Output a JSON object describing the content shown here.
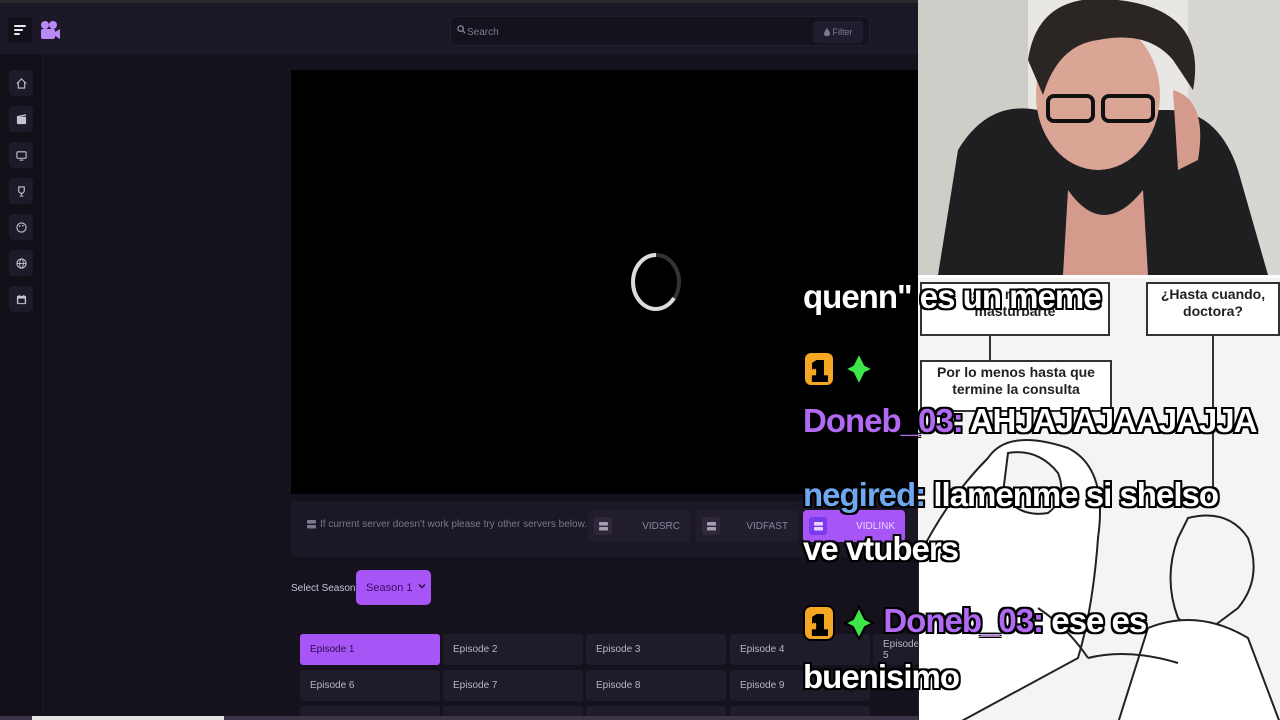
{
  "topbar": {
    "search_placeholder": "Search",
    "filter_label": "Filter"
  },
  "sidebar": {
    "items": [
      {
        "icon": "home-icon"
      },
      {
        "icon": "film-icon"
      },
      {
        "icon": "tv-icon"
      },
      {
        "icon": "trophy-icon"
      },
      {
        "icon": "palette-icon"
      },
      {
        "icon": "globe-icon"
      },
      {
        "icon": "calendar-icon"
      }
    ]
  },
  "servers": {
    "note": "If current server doesn't work please try other servers below.",
    "items": [
      {
        "label": "VIDSRC",
        "active": false
      },
      {
        "label": "VIDFAST",
        "active": false
      },
      {
        "label": "VIDLINK",
        "active": true
      }
    ]
  },
  "season": {
    "label": "Select Season:",
    "selected": "Season 1"
  },
  "episodes": [
    {
      "label": "Episode 1",
      "active": true
    },
    {
      "label": "Episode 2"
    },
    {
      "label": "Episode 3"
    },
    {
      "label": "Episode 4"
    },
    {
      "label": "Episode 5"
    },
    {
      "label": "Episode 6"
    },
    {
      "label": "Episode 7"
    },
    {
      "label": "Episode 8"
    },
    {
      "label": "Episode 9"
    }
  ],
  "comic": {
    "bubble1": "es un meme de masturbarte",
    "bubble2": "¿Hasta cuando, doctora?",
    "bubble3": "Por lo menos hasta que termine la consulta"
  },
  "chat": {
    "line1": "quenn\" es un meme",
    "badge1": "1",
    "line3_user": "Doneb_03:",
    "line3_msg": "AHJAJAJAAJAJJA",
    "line4_user": "negired:",
    "line4_msg": "llamenme si shelso",
    "line5": "ve vtubers",
    "badge2": "1",
    "line6_user": "Doneb_03:",
    "line6_msg": "ese es",
    "line7": "buenisimo"
  },
  "colors": {
    "accent": "#a855f7",
    "background": "#15121d",
    "chat_purple": "#b26af5",
    "chat_blue": "#6fa8f0"
  }
}
